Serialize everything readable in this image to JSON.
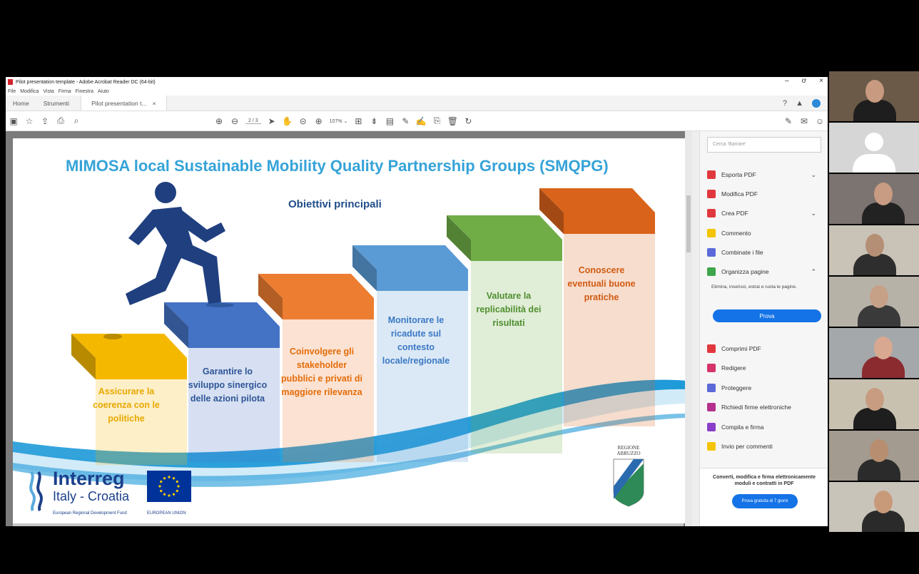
{
  "window": {
    "title": "Pilot presentation template - Adobe Acrobat Reader DC (64-bit)",
    "controls": [
      "–",
      "ơ",
      "×"
    ]
  },
  "menu": [
    "File",
    "Modifica",
    "Vista",
    "Firma",
    "Finestra",
    "Aiuto"
  ],
  "tabs": {
    "home": "Home",
    "tools": "Strumenti",
    "document": "Pilot presentation t...",
    "close": "×"
  },
  "toolbar": {
    "page_current": "2",
    "page_total": "/ 3",
    "zoom": "107%"
  },
  "slide": {
    "title": "MIMOSA local Sustainable Mobility Quality Partnership Groups (SMQPG)",
    "subtitle": "Obiettivi principali",
    "steps": [
      {
        "label": "Assicurare la coerenza con le politiche",
        "color": "#f5b800"
      },
      {
        "label": "Garantire lo sviluppo sinergico delle azioni pilota",
        "color": "#4472c4"
      },
      {
        "label": "Coinvolgere gli stakeholder pubblici e privati di maggiore rilevanza",
        "color": "#ed7d31"
      },
      {
        "label": "Monitorare le ricadute sul contesto locale/regionale",
        "color": "#5b9bd5"
      },
      {
        "label": "Valutare la replicabilità dei risultati",
        "color": "#70ad47"
      },
      {
        "label": "Conoscere eventuali buone pratiche",
        "color": "#d9631a"
      }
    ],
    "logo": {
      "name": "Interreg",
      "program": "Italy - Croatia",
      "fund": "European Regional Development Fund",
      "eu": "EUROPEAN UNION"
    },
    "partner": "REGIONE ABRUZZO"
  },
  "tools_panel": {
    "search_placeholder": "Cerca 'Barrare'",
    "items": [
      {
        "label": "Esporta PDF",
        "color": "#e0383e",
        "chevron": "⌄"
      },
      {
        "label": "Modifica PDF",
        "color": "#e0383e",
        "chevron": ""
      },
      {
        "label": "Crea PDF",
        "color": "#e0383e",
        "chevron": "⌄"
      },
      {
        "label": "Commento",
        "color": "#f4c400",
        "chevron": ""
      },
      {
        "label": "Combinate i file",
        "color": "#5b6ad8",
        "chevron": ""
      },
      {
        "label": "Organizza pagine",
        "color": "#3ea54b",
        "chevron": "⌃"
      }
    ],
    "organize_desc": "Elimina, inserisci, estrai e ruota le pagine.",
    "try_button": "Prova",
    "more_items": [
      {
        "label": "Comprimi PDF",
        "color": "#e0383e"
      },
      {
        "label": "Redigere",
        "color": "#d6336c"
      },
      {
        "label": "Proteggere",
        "color": "#5b6ad8"
      },
      {
        "label": "Richiedi firme elettroniche",
        "color": "#b6318e"
      },
      {
        "label": "Compila e firma",
        "color": "#8a3ec8"
      },
      {
        "label": "Invio per commenti",
        "color": "#f4c400"
      }
    ],
    "promo_text": "Converti, modifica e firma elettronicamente moduli e contratti in PDF",
    "promo_button": "Prova gratuita di 7 giorni"
  },
  "participants": [
    {
      "bg": "#6b5a48",
      "skin": "#c89a80",
      "shirt": "#1e1e1e",
      "type": "video"
    },
    {
      "bg": "#d6d6d6",
      "skin": "#b8b8b8",
      "shirt": "#b8b8b8",
      "type": "placeholder"
    },
    {
      "bg": "#7c7470",
      "skin": "#c89c82",
      "shirt": "#222222",
      "type": "video"
    },
    {
      "bg": "#c9c2b6",
      "skin": "#b48f75",
      "shirt": "#2e2e2e",
      "type": "video"
    },
    {
      "bg": "#b7b2a8",
      "skin": "#c7a088",
      "shirt": "#3a3a3a",
      "type": "video"
    },
    {
      "bg": "#a5a8aa",
      "skin": "#d8a890",
      "shirt": "#8b2b2f",
      "type": "video"
    },
    {
      "bg": "#c8c1b0",
      "skin": "#c79c80",
      "shirt": "#1e1e1e",
      "type": "video"
    },
    {
      "bg": "#a39a90",
      "skin": "#b88e70",
      "shirt": "#2b2b2b",
      "type": "video"
    },
    {
      "bg": "#c9c4ba",
      "skin": "#c89a7a",
      "shirt": "#2a2a2a",
      "type": "video"
    }
  ]
}
